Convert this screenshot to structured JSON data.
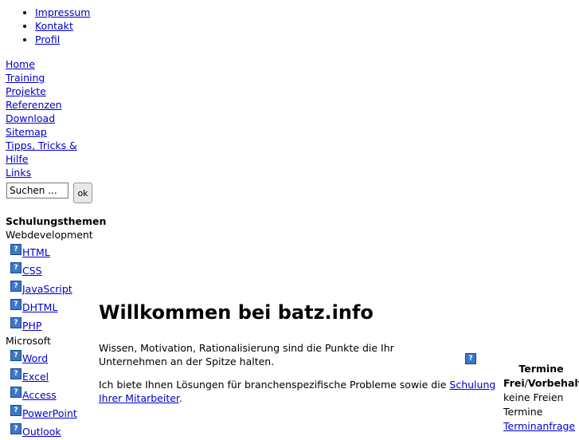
{
  "top_links": [
    "Impressum",
    "Kontakt",
    "Profil"
  ],
  "nav": [
    "Home",
    "Training",
    "Projekte",
    "Referenzen",
    "Download",
    "Sitemap",
    "Tipps, Tricks &",
    "Hilfe",
    "Links"
  ],
  "search": {
    "value": "Suchen ...",
    "button": "ok"
  },
  "themes": {
    "heading": "Schulungsthemen",
    "web": "Webdevelopment",
    "web_items": [
      "HTML",
      "CSS",
      "JavaScript",
      "DHTML",
      "PHP"
    ],
    "ms": "Microsoft",
    "ms_items": [
      "Word",
      "Excel",
      "Access",
      "PowerPoint",
      "Outlook"
    ]
  },
  "main": {
    "title": "Willkommen bei batz.info",
    "intro": "Wissen, Motivation, Rationalisierung sind die Punkte die Ihr Unternehmen an der Spitze halten.",
    "solutions_text": "Ich biete Ihnen Lösungen für branchenspezifische Probleme sowie die ",
    "solutions_link": "Schulung Ihrer Mitarbeiter",
    "solutions_end": "."
  },
  "termine": {
    "heading_1": "Termine",
    "heading_2a": "Frei",
    "heading_sep": "/",
    "heading_2b": "Vorbehalt",
    "none": "keine Freien Termine",
    "link": "Terminanfrage"
  },
  "icons": {
    "help": "question-mark-icon"
  },
  "colors": {
    "link": "#0000cc",
    "icon": "#3a78c8"
  }
}
